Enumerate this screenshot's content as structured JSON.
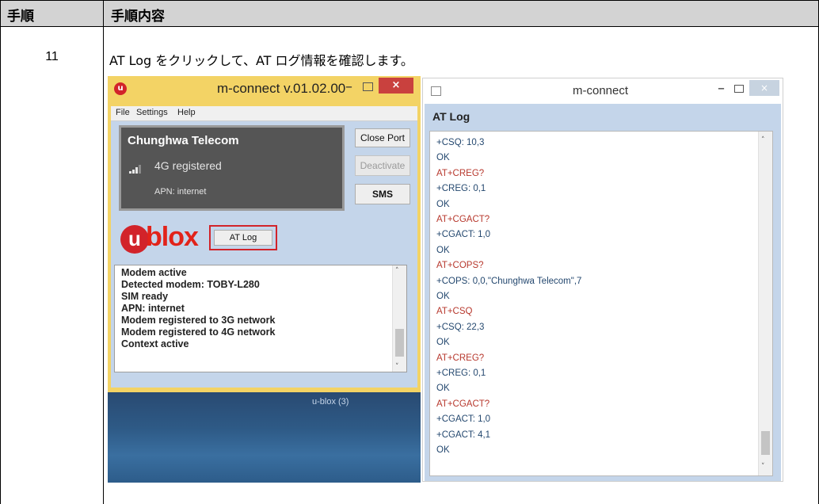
{
  "table": {
    "header": {
      "col1": "手順",
      "col2": "手順内容"
    },
    "row": {
      "step": "11",
      "text": "AT Log をクリックして、AT ログ情報を確認します。"
    }
  },
  "left_window": {
    "title": "m-connect v.01.02.00",
    "icon_letter": "u",
    "controls": {
      "minimize": "–",
      "close": "×"
    },
    "menu": [
      "File",
      "Settings",
      "Help"
    ],
    "status": {
      "carrier": "Chunghwa Telecom",
      "registration": "4G registered",
      "apn": "APN: internet"
    },
    "buttons": {
      "close_port": "Close Port",
      "deactivate": "Deactivate",
      "sms": "SMS",
      "at_log": "AT Log"
    },
    "logo": {
      "letter": "u",
      "text": "blox"
    },
    "messages": [
      "Modem active",
      "Detected modem: TOBY-L280",
      "SIM ready",
      "APN: internet",
      "Modem registered to 3G network",
      "Modem registered to 4G network",
      "Context active"
    ],
    "scroll_up": "˄",
    "scroll_down": "˅"
  },
  "desktop": {
    "label": "u-blox (3)"
  },
  "right_window": {
    "title": "m-connect",
    "controls": {
      "minimize": "–",
      "close": "×"
    },
    "section_title": "AT Log",
    "log": [
      {
        "text": "+CSQ: 10,3",
        "kind": "resp"
      },
      {
        "text": "OK",
        "kind": "resp"
      },
      {
        "text": "AT+CREG?",
        "kind": "cmd"
      },
      {
        "text": "+CREG: 0,1",
        "kind": "resp"
      },
      {
        "text": "OK",
        "kind": "resp"
      },
      {
        "text": "AT+CGACT?",
        "kind": "cmd"
      },
      {
        "text": "+CGACT: 1,0",
        "kind": "resp"
      },
      {
        "text": "OK",
        "kind": "resp"
      },
      {
        "text": "AT+COPS?",
        "kind": "cmd"
      },
      {
        "text": "+COPS: 0,0,\"Chunghwa Telecom\",7",
        "kind": "resp"
      },
      {
        "text": "OK",
        "kind": "resp"
      },
      {
        "text": "AT+CSQ",
        "kind": "cmd"
      },
      {
        "text": "+CSQ: 22,3",
        "kind": "resp"
      },
      {
        "text": "OK",
        "kind": "resp"
      },
      {
        "text": "AT+CREG?",
        "kind": "cmd"
      },
      {
        "text": "+CREG: 0,1",
        "kind": "resp"
      },
      {
        "text": "OK",
        "kind": "resp"
      },
      {
        "text": "AT+CGACT?",
        "kind": "cmd"
      },
      {
        "text": "+CGACT: 1,0",
        "kind": "resp"
      },
      {
        "text": "+CGACT: 4,1",
        "kind": "resp"
      },
      {
        "text": "OK",
        "kind": "resp"
      }
    ],
    "scroll_up": "˄",
    "scroll_down": "˅"
  },
  "colors": {
    "header_bg": "#d3d3d3",
    "window_frame": "#f3d365",
    "client_bg": "#c4d5ea",
    "log_command": "#b7382d",
    "log_response": "#24486f",
    "brand_red": "#d2232a"
  }
}
